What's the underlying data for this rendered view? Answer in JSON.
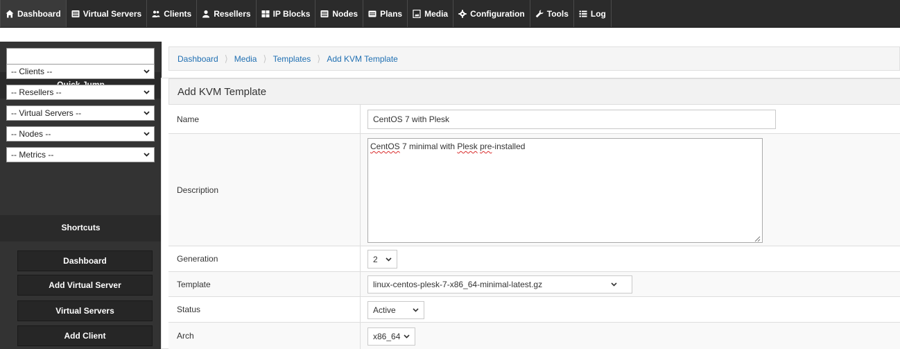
{
  "nav": {
    "items": [
      {
        "label": "Dashboard",
        "icon": "home-icon"
      },
      {
        "label": "Virtual Servers",
        "icon": "server-list-icon"
      },
      {
        "label": "Clients",
        "icon": "users-icon"
      },
      {
        "label": "Resellers",
        "icon": "user-icon"
      },
      {
        "label": "IP Blocks",
        "icon": "grid-icon"
      },
      {
        "label": "Nodes",
        "icon": "server-list-icon"
      },
      {
        "label": "Plans",
        "icon": "card-icon"
      },
      {
        "label": "Media",
        "icon": "media-icon"
      },
      {
        "label": "Configuration",
        "icon": "gear-icon"
      },
      {
        "label": "Tools",
        "icon": "wrench-icon"
      },
      {
        "label": "Log",
        "icon": "list-icon"
      }
    ]
  },
  "sidebar": {
    "search_value": "",
    "quick_jump_title": "Quick Jump",
    "quick_jump_selects": [
      "-- Clients --",
      "-- Resellers --",
      "-- Virtual Servers --",
      "-- Nodes --",
      "-- Metrics --"
    ],
    "shortcuts_title": "Shortcuts",
    "shortcuts": [
      "Dashboard",
      "Add Virtual Server",
      "Virtual Servers",
      "Add Client"
    ]
  },
  "breadcrumb": [
    "Dashboard",
    "Media",
    "Templates",
    "Add KVM Template"
  ],
  "panel": {
    "title": "Add KVM Template"
  },
  "form": {
    "name_label": "Name",
    "name_value": "CentOS 7 with Plesk",
    "description_label": "Description",
    "description_value": {
      "w1": "CentOS",
      "w2": " 7 minimal with ",
      "w3": "Plesk",
      "w4": " ",
      "w5": "pre",
      "w6": "-installed"
    },
    "generation_label": "Generation",
    "generation_value": "2",
    "template_label": "Template",
    "template_value": "linux-centos-plesk-7-x86_64-minimal-latest.gz",
    "status_label": "Status",
    "status_value": "Active",
    "arch_label": "Arch",
    "arch_value": "x86_64"
  },
  "colors": {
    "topbar": "#2b2b2b",
    "sidebar": "#333333",
    "link": "#1f6fb2"
  }
}
